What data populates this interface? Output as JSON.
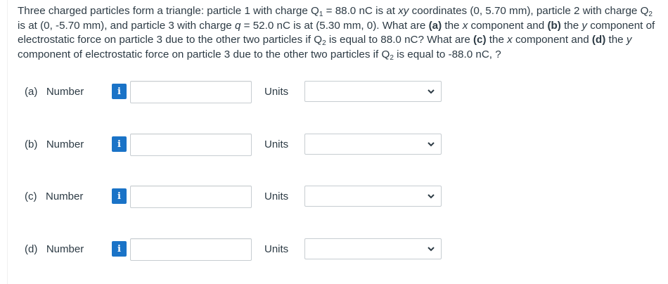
{
  "question": {
    "line1": {
      "a": "Three charged particles form a triangle: particle 1 with charge Q",
      "sub1": "1",
      "b": " = 88.0 nC is at ",
      "xy": "xy",
      "c": " coordinates (0, 5.70 mm), particle 2 with charge Q",
      "sub2": "2"
    },
    "line2": {
      "a": "is at (0, -5.70 mm), and particle 3 with charge ",
      "q": "q",
      "b": " = 52.0 nC is at (5.30 mm, 0). What are ",
      "pa": "(a)",
      "c": " the ",
      "x": "x",
      "d": " component and ",
      "pb": "(b)",
      "e": " the ",
      "y": "y",
      "f": " component of"
    },
    "line3": {
      "a": "electrostatic force on particle 3 due to the other two particles if Q",
      "sub": "2",
      "b": " is equal to 88.0 nC? What are ",
      "pc": "(c)",
      "c": " the ",
      "x": "x",
      "d": " component and ",
      "pd": "(d)",
      "e": " the ",
      "y": "y"
    },
    "line4": {
      "a": "component of electrostatic force on particle 3 due to the other two particles if Q",
      "sub": "2",
      "b": " is equal to -88.0 nC, ?"
    }
  },
  "rows": [
    {
      "label": "(a)   Number",
      "info": "i",
      "value": "",
      "units_label": "Units",
      "units_value": ""
    },
    {
      "label": "(b)   Number",
      "info": "i",
      "value": "",
      "units_label": "Units",
      "units_value": ""
    },
    {
      "label": "(c)   Number",
      "info": "i",
      "value": "",
      "units_label": "Units",
      "units_value": ""
    },
    {
      "label": "(d)   Number",
      "info": "i",
      "value": "",
      "units_label": "Units",
      "units_value": ""
    }
  ],
  "colors": {
    "info_button": "#1a73c7",
    "text": "#2d3b45",
    "input_border": "#c7cdd1"
  },
  "icons": {
    "info": "info-icon",
    "dropdown": "chevron-down-icon"
  }
}
